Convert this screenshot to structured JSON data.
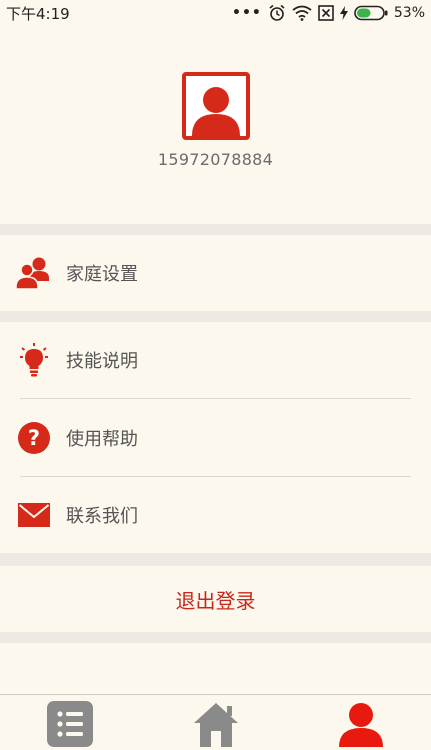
{
  "status_bar": {
    "time": "下午4:19",
    "battery": "53%",
    "battery_level": 0.53
  },
  "profile": {
    "phone": "15972078884"
  },
  "menu": {
    "family_settings": "家庭设置",
    "skills": "技能说明",
    "help": "使用帮助",
    "contact": "联系我们"
  },
  "logout_label": "退出登录",
  "colors": {
    "accent": "#d5291a",
    "background": "#fdf8ee",
    "inactive_tab": "#8a8a8a"
  },
  "icons": {
    "family": "family-icon",
    "bulb": "lightbulb-icon",
    "help": "question-icon",
    "mail": "mail-icon"
  }
}
